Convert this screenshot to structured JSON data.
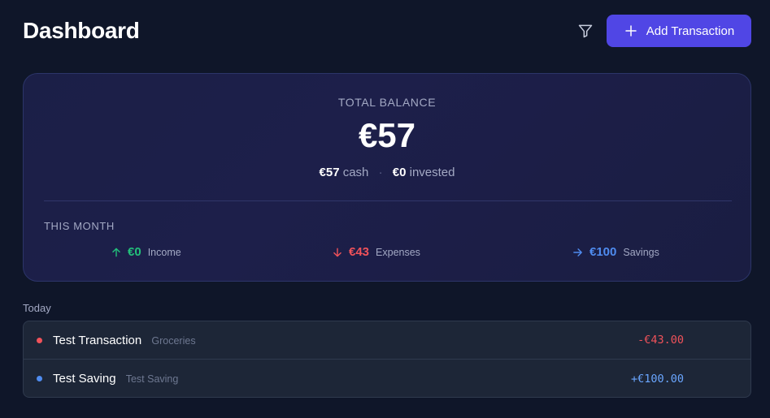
{
  "header": {
    "title": "Dashboard",
    "filter_icon": "filter-icon",
    "add_button_label": "Add Transaction",
    "add_icon": "plus-icon"
  },
  "balance": {
    "label": "TOTAL BALANCE",
    "amount": "€57",
    "cash_value": "€57",
    "cash_label": "cash",
    "separator": "·",
    "invested_value": "€0",
    "invested_label": "invested"
  },
  "this_month": {
    "label": "THIS MONTH",
    "income": {
      "value": "€0",
      "label": "Income",
      "color": "#22c07a",
      "icon": "arrow-up-icon"
    },
    "expenses": {
      "value": "€43",
      "label": "Expenses",
      "color": "#f0525a",
      "icon": "arrow-down-icon"
    },
    "savings": {
      "value": "€100",
      "label": "Savings",
      "color": "#4f8cf0",
      "icon": "arrow-right-icon"
    }
  },
  "transactions": {
    "section_label": "Today",
    "items": [
      {
        "name": "Test Transaction",
        "category": "Groceries",
        "amount": "-€43.00",
        "color": "#f0525a"
      },
      {
        "name": "Test Saving",
        "category": "Test Saving",
        "amount": "+€100.00",
        "color": "#4f8cf0"
      }
    ]
  },
  "colors": {
    "background": "#0f1629",
    "accent": "#5046e5",
    "income": "#22c07a",
    "expense": "#f0525a",
    "saving": "#4f8cf0"
  }
}
